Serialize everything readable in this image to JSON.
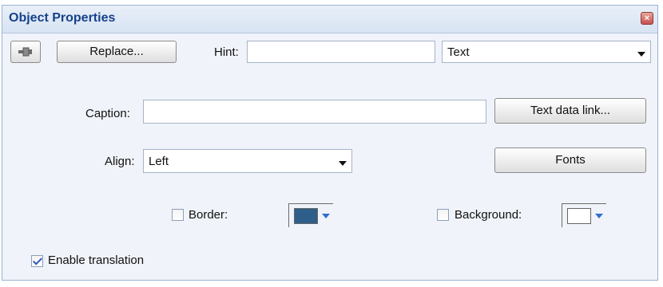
{
  "window": {
    "title": "Object Properties",
    "close_icon": "close-icon"
  },
  "toolbar": {
    "pin_icon": "pin-icon",
    "replace_label": "Replace...",
    "hint_label": "Hint:",
    "hint_value": "",
    "type_value": "Text"
  },
  "caption": {
    "label": "Caption:",
    "value": "",
    "link_button": "Text data link..."
  },
  "align": {
    "label": "Align:",
    "value": "Left",
    "fonts_button": "Fonts"
  },
  "border": {
    "label": "Border:",
    "checked": false,
    "color": "#2e5f8a"
  },
  "background": {
    "label": "Background:",
    "checked": false,
    "color": "#ffffff"
  },
  "translation": {
    "label": "Enable translation",
    "checked": true
  }
}
